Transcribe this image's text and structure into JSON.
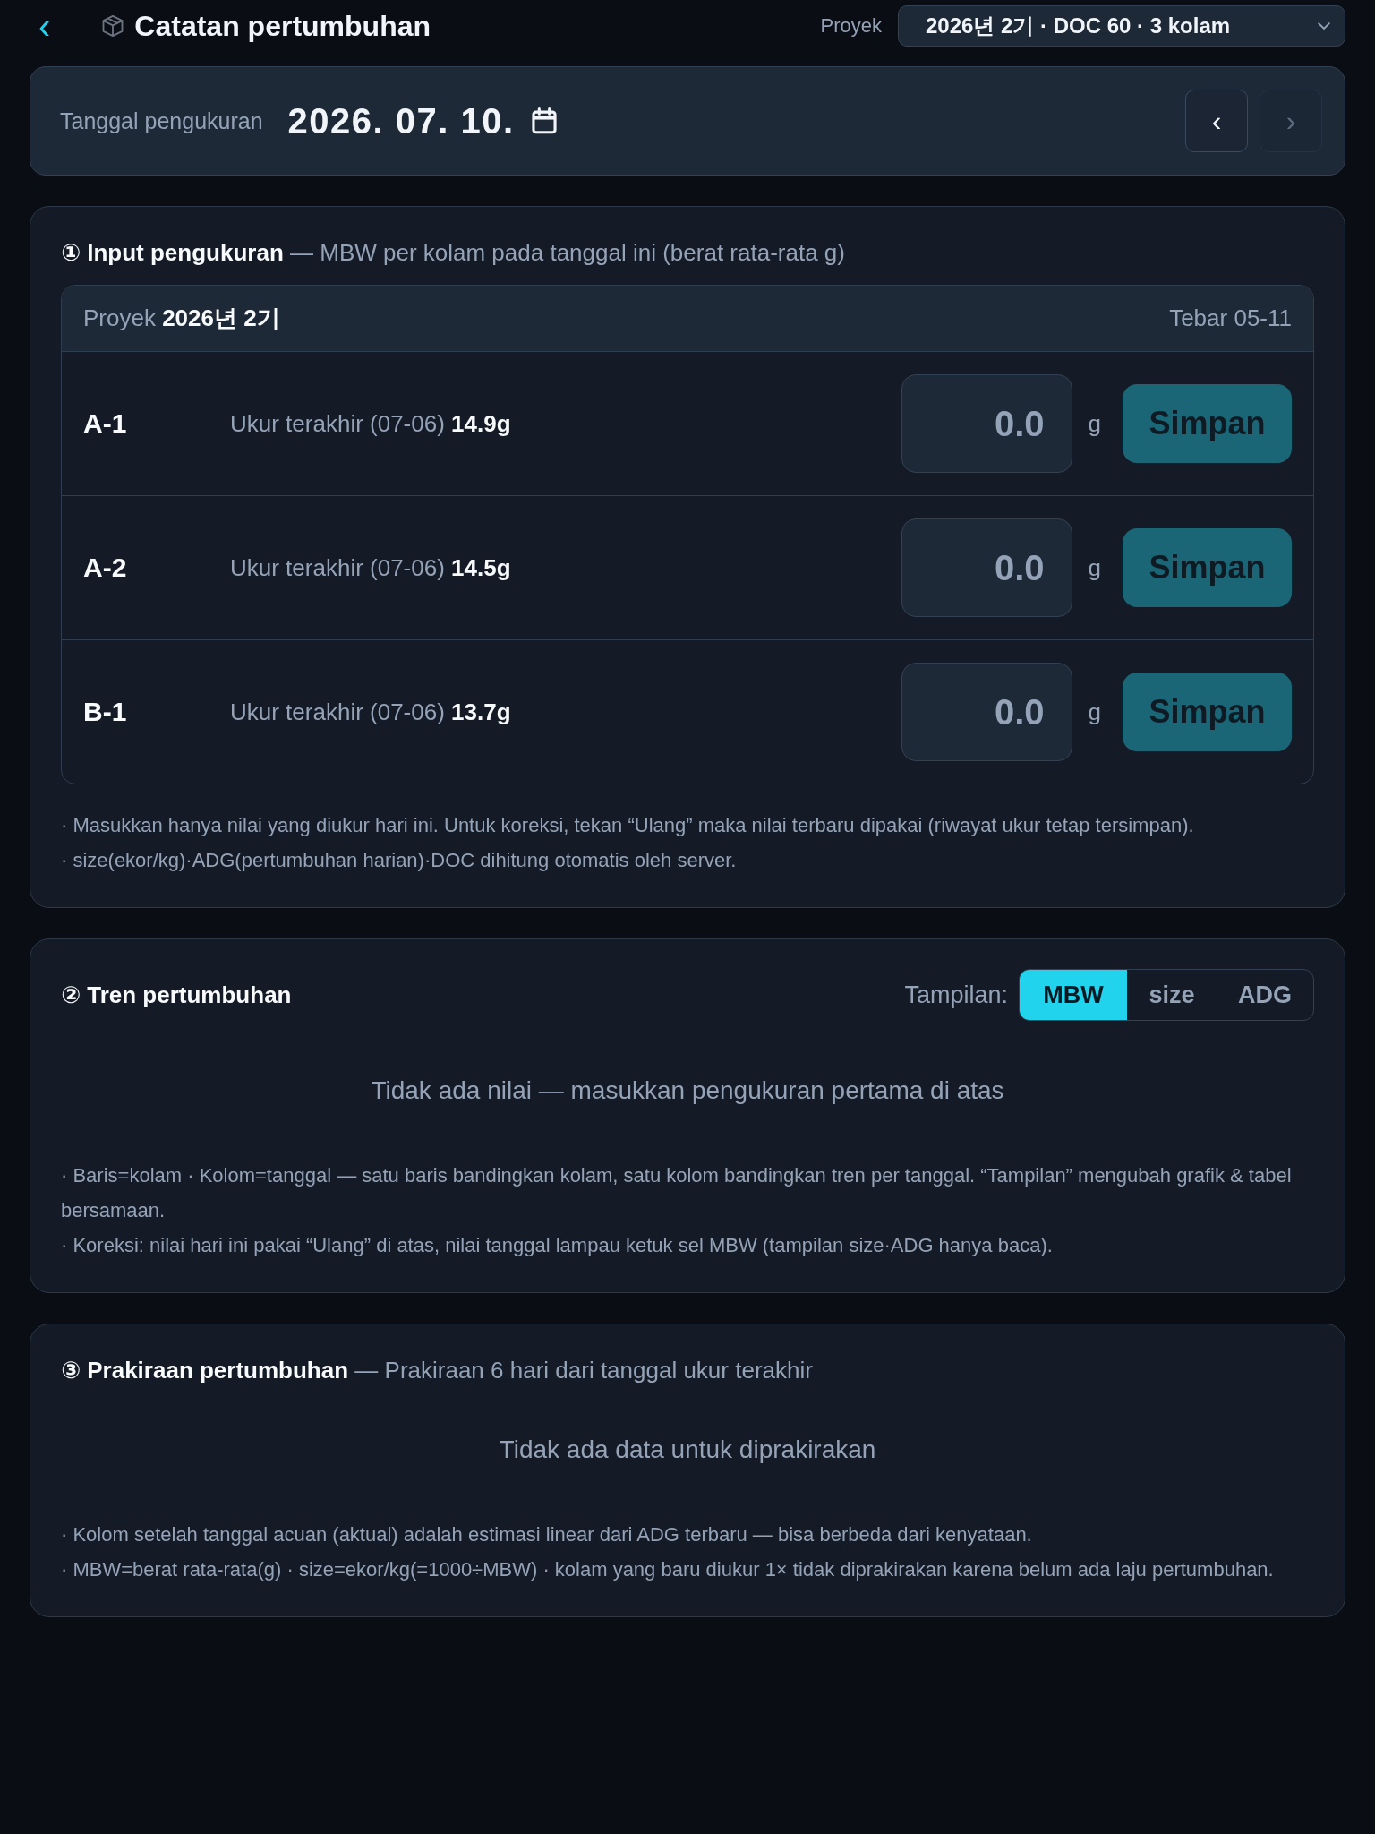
{
  "header": {
    "back": "‹",
    "title": "Catatan pertumbuhan",
    "project_label": "Proyek",
    "project_select": {
      "value": "2026년 2기 · DOC 60 · 3 kolam"
    }
  },
  "date_bar": {
    "label": "Tanggal pengukuran",
    "date": "2026. 07. 10.",
    "prev": {
      "label": "‹",
      "disabled": false
    },
    "next": {
      "label": "›",
      "disabled": true
    }
  },
  "input_section": {
    "title": "**① Input pengukuran** — MBW per kolam pada tanggal ini (berat rata-rata g)",
    "table": {
      "project": "Proyek **2026년 2기**",
      "stocking": "Tebar 05-11",
      "rows": [
        {
          "pond": "A-1",
          "last": "Ukur terakhir (07-06) **14.9g**",
          "placeholder": "0.0",
          "unit": "g",
          "button": "Simpan"
        },
        {
          "pond": "A-2",
          "last": "Ukur terakhir (07-06) **14.5g**",
          "placeholder": "0.0",
          "unit": "g",
          "button": "Simpan"
        },
        {
          "pond": "B-1",
          "last": "Ukur terakhir (07-06) **13.7g**",
          "placeholder": "0.0",
          "unit": "g",
          "button": "Simpan"
        }
      ]
    },
    "notes": [
      "· Masukkan hanya nilai yang diukur hari ini. Untuk koreksi, tekan “Ulang” maka nilai terbaru dipakai (riwayat ukur tetap tersimpan).",
      "· size(ekor/kg)·ADG(pertumbuhan harian)·DOC dihitung otomatis oleh server."
    ]
  },
  "trend_section": {
    "title": "② Tren pertumbuhan",
    "view_label": "Tampilan:",
    "views": [
      {
        "label": "MBW",
        "selected": true
      },
      {
        "label": "size",
        "selected": false
      },
      {
        "label": "ADG",
        "selected": false
      }
    ],
    "empty": "Tidak ada nilai — masukkan pengukuran pertama di atas",
    "notes": [
      "· Baris=kolam · Kolom=tanggal — satu baris bandingkan kolam, satu kolom bandingkan tren per tanggal. “Tampilan” mengubah grafik & tabel bersamaan.",
      "· Koreksi: nilai hari ini pakai “Ulang” di atas, nilai tanggal lampau ketuk sel MBW (tampilan size·ADG hanya baca)."
    ]
  },
  "forecast_section": {
    "title": "**③ Prakiraan pertumbuhan** — Prakiraan 6 hari dari tanggal ukur terakhir",
    "empty": "Tidak ada data untuk diprakirakan",
    "notes": [
      "· Kolom setelah tanggal acuan (aktual) adalah estimasi linear dari ADG terbaru — bisa berbeda dari kenyataan.",
      "· MBW=berat rata-rata(g) · size=ekor/kg(=1000÷MBW) · kolam yang baru diukur 1× tidak diprakirakan karena belum ada laju pertumbuhan."
    ]
  }
}
